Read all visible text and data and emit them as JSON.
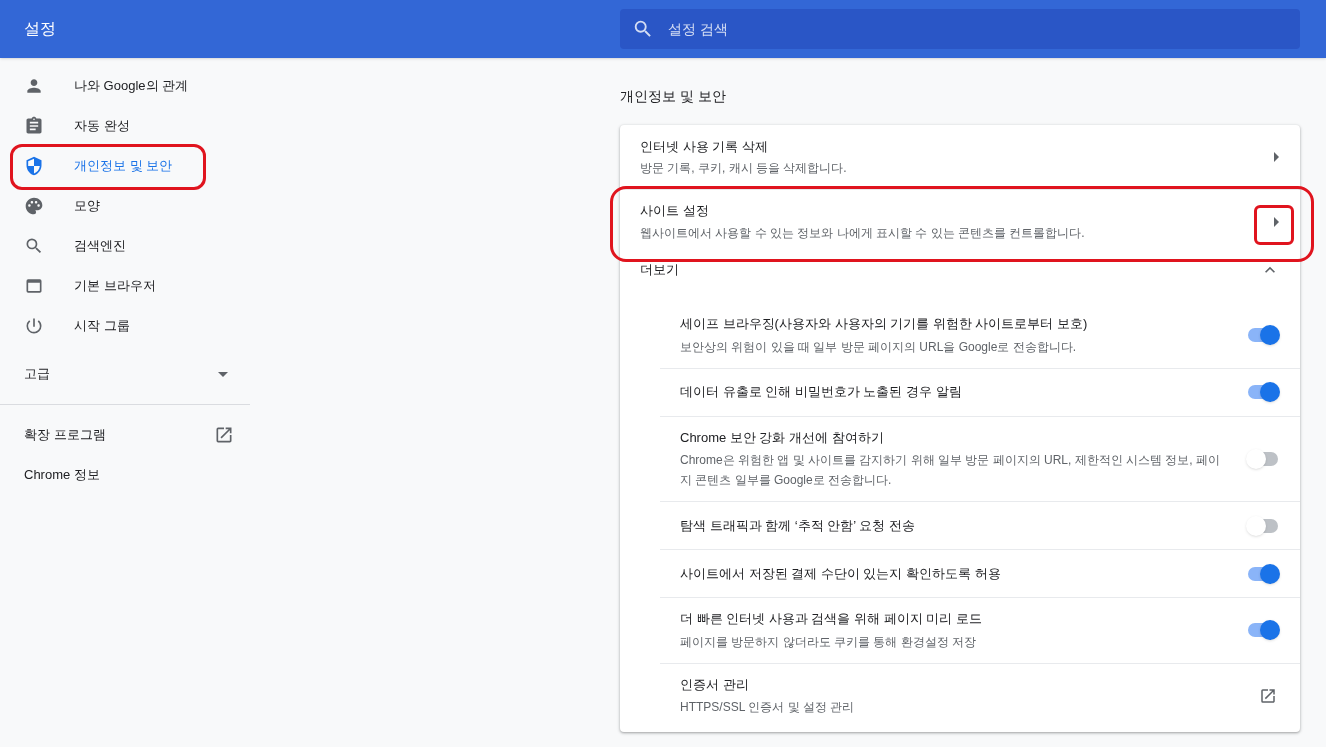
{
  "header": {
    "title": "설정",
    "search": {
      "placeholder": "설정 검색"
    }
  },
  "sidebar": {
    "items": [
      {
        "label": "나와 Google의 관계",
        "selected": false,
        "annotated": false
      },
      {
        "label": "자동 완성",
        "selected": false,
        "annotated": false
      },
      {
        "label": "개인정보 및 보안",
        "selected": true,
        "annotated": true
      },
      {
        "label": "모양",
        "selected": false,
        "annotated": false
      },
      {
        "label": "검색엔진",
        "selected": false,
        "annotated": false
      },
      {
        "label": "기본 브라우저",
        "selected": false,
        "annotated": false
      },
      {
        "label": "시작 그룹",
        "selected": false,
        "annotated": false
      }
    ],
    "advanced": {
      "label": "고급",
      "expanded": false
    },
    "extensions": {
      "label": "확장 프로그램"
    },
    "about": {
      "label": "Chrome 정보"
    }
  },
  "section": {
    "title": "개인정보 및 보안",
    "rows": [
      {
        "title": "인터넷 사용 기록 삭제",
        "subtitle": "방문 기록, 쿠키, 캐시 등을 삭제합니다.",
        "annotated": false
      },
      {
        "title": "사이트 설정",
        "subtitle": "웹사이트에서 사용할 수 있는 정보와 나에게 표시할 수 있는 콘텐츠를 컨트롤합니다.",
        "annotated": true
      }
    ],
    "more": {
      "label": "더보기",
      "expanded": true
    },
    "items": [
      {
        "kind": "toggle",
        "title": "세이프 브라우징(사용자와 사용자의 기기를 위험한 사이트로부터 보호)",
        "subtitle": "보안상의 위험이 있을 때 일부 방문 페이지의 URL을 Google로 전송합니다.",
        "on": true
      },
      {
        "kind": "toggle",
        "title": "데이터 유출로 인해 비밀번호가 노출된 경우 알림",
        "on": true
      },
      {
        "kind": "toggle",
        "title": "Chrome 보안 강화 개선에 참여하기",
        "subtitle": "Chrome은 위험한 앱 및 사이트를 감지하기 위해 일부 방문 페이지의 URL, 제한적인 시스템 정보, 페이지 콘텐츠 일부를 Google로 전송합니다.",
        "on": false
      },
      {
        "kind": "toggle",
        "title": "탐색 트래픽과 함께 ‘추적 안함’ 요청 전송",
        "on": false
      },
      {
        "kind": "toggle",
        "title": "사이트에서 저장된 결제 수단이 있는지 확인하도록 허용",
        "on": true
      },
      {
        "kind": "toggle",
        "title": "더 빠른 인터넷 사용과 검색을 위해 페이지 미리 로드",
        "subtitle": "페이지를 방문하지 않더라도 쿠키를 통해 환경설정 저장",
        "on": true
      },
      {
        "kind": "link",
        "title": "인증서 관리",
        "subtitle": "HTTPS/SSL 인증서 및 설정 관리"
      }
    ]
  }
}
